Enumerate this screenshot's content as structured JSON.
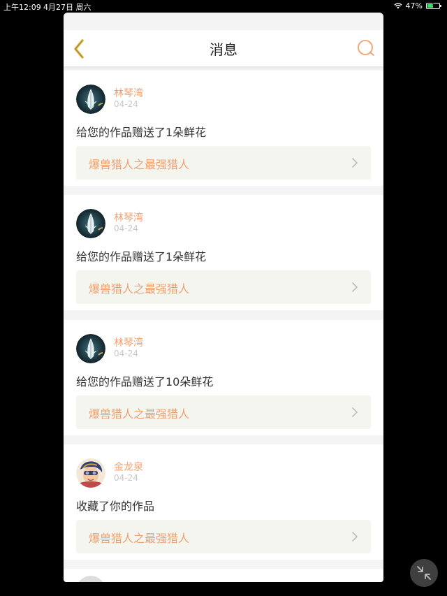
{
  "status_bar": {
    "time": "上午12:09",
    "date": "4月27日 周六",
    "battery": "47%"
  },
  "header": {
    "title": "消息"
  },
  "colors": {
    "accent": "#f0a070",
    "back_icon": "#d9b23a",
    "search_icon": "#f0a070"
  },
  "messages": [
    {
      "name": "林琴湾",
      "date": "04-24",
      "text": "给您的作品赠送了1朵鲜花",
      "work": "爆兽猎人之最强猎人",
      "avatar": "feather-avatar"
    },
    {
      "name": "林琴湾",
      "date": "04-24",
      "text": "给您的作品赠送了1朵鲜花",
      "work": "爆兽猎人之最强猎人",
      "avatar": "feather-avatar"
    },
    {
      "name": "林琴湾",
      "date": "04-24",
      "text": "给您的作品赠送了10朵鲜花",
      "work": "爆兽猎人之最强猎人",
      "avatar": "feather-avatar"
    },
    {
      "name": "金龙泉",
      "date": "04-24",
      "text": "收藏了你的作品",
      "work": "爆兽猎人之最强猎人",
      "avatar": "character-avatar"
    }
  ]
}
